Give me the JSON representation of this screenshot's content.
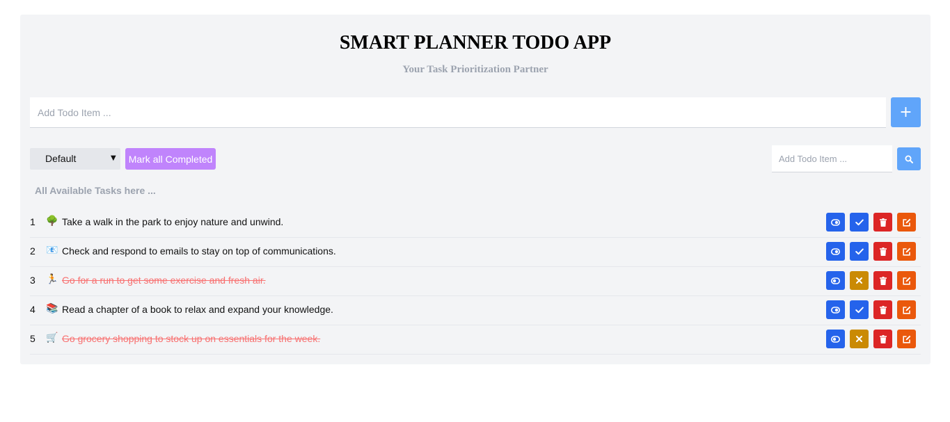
{
  "header": {
    "title": "SMART PLANNER TODO APP",
    "subtitle": "Your Task Prioritization Partner"
  },
  "add_todo": {
    "placeholder": "Add Todo Item ...",
    "value": "",
    "button_icon": "plus-icon",
    "button_label": "+"
  },
  "toolbar": {
    "filter_selected": "Default",
    "mark_all_label": "Mark all Completed",
    "search_placeholder": "Add Todo Item ...",
    "search_icon": "search-icon"
  },
  "section_label": "All Available Tasks here ...",
  "tasks": [
    {
      "num": "1",
      "emoji": "🌳",
      "text": "Take a walk in the park to enjoy nature and unwind.",
      "completed": false
    },
    {
      "num": "2",
      "emoji": "📧",
      "text": "Check and respond to emails to stay on top of communications.",
      "completed": false
    },
    {
      "num": "3",
      "emoji": "🏃",
      "text": "Go for a run to get some exercise and fresh air.",
      "completed": true
    },
    {
      "num": "4",
      "emoji": "📚",
      "text": "Read a chapter of a book to relax and expand your knowledge.",
      "completed": false
    },
    {
      "num": "5",
      "emoji": "🛒",
      "text": "Go grocery shopping to stock up on essentials for the week.",
      "completed": true
    }
  ],
  "colors": {
    "accent_blue": "#2563eb",
    "light_blue": "#60a5fa",
    "purple": "#c084fc",
    "red": "#dc2626",
    "orange": "#ea580c",
    "amber": "#ca8a04",
    "completed_text": "#f87171"
  }
}
